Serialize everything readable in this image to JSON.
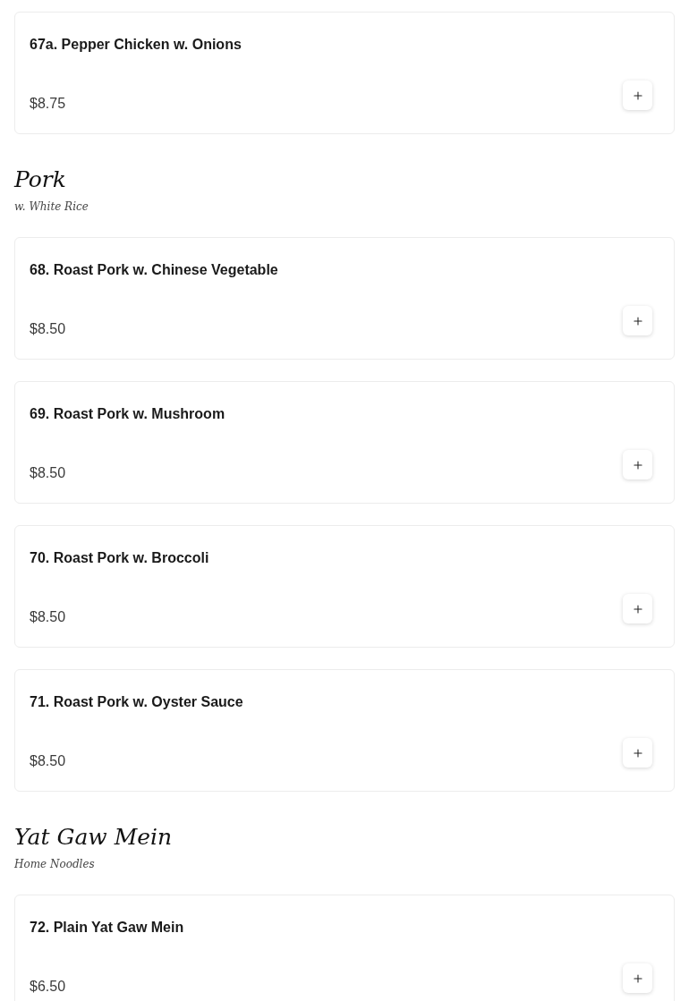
{
  "sections": [
    {
      "items": [
        {
          "name": "67a. Pepper Chicken w. Onions",
          "price": "$8.75"
        }
      ]
    },
    {
      "title": "Pork",
      "subtitle": "w. White Rice",
      "items": [
        {
          "name": "68. Roast Pork w. Chinese Vegetable",
          "price": "$8.50"
        },
        {
          "name": "69. Roast Pork w. Mushroom",
          "price": "$8.50"
        },
        {
          "name": "70. Roast Pork w. Broccoli",
          "price": "$8.50"
        },
        {
          "name": "71. Roast Pork w. Oyster Sauce",
          "price": "$8.50"
        }
      ]
    },
    {
      "title": "Yat Gaw Mein",
      "subtitle": "Home Noodles",
      "items": [
        {
          "name": "72. Plain Yat Gaw Mein",
          "price": "$6.50"
        }
      ]
    }
  ]
}
